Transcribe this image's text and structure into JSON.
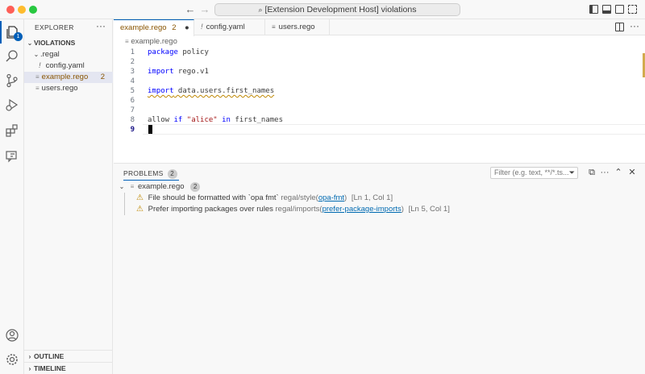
{
  "window": {
    "title": "[Extension Development Host] violations",
    "back_icon": "arrow-left",
    "forward_icon": "arrow-right"
  },
  "activity_bar": {
    "explorer_badge": "1",
    "items": [
      "files-icon",
      "search-icon",
      "source-control-icon",
      "run-debug-icon",
      "extensions-icon",
      "remote-explorer-icon",
      "account-icon",
      "gear-icon"
    ]
  },
  "sidebar": {
    "title": "EXPLORER",
    "more": "···",
    "folder": "VIOLATIONS",
    "items": [
      {
        "label": ".regal",
        "icon": "chevron-down"
      },
      {
        "label": "config.yaml",
        "icon": "!"
      },
      {
        "label": "example.rego",
        "badge": "2"
      },
      {
        "label": "users.rego"
      }
    ],
    "outline": "OUTLINE",
    "timeline": "TIMELINE"
  },
  "tabs": [
    {
      "label": "example.rego",
      "count": "2",
      "dirty": "●",
      "active": true
    },
    {
      "label": "config.yaml",
      "icon": "!"
    },
    {
      "label": "users.rego"
    }
  ],
  "breadcrumb": "example.rego",
  "code": {
    "lines": [
      {
        "n": "1",
        "kw": "package",
        "rest": " policy"
      },
      {
        "n": "2"
      },
      {
        "n": "3",
        "kw": "import",
        "rest": " rego.v1"
      },
      {
        "n": "4"
      },
      {
        "n": "5",
        "kw": "import",
        "rest": " data.users.first_names"
      },
      {
        "n": "6"
      },
      {
        "n": "7"
      },
      {
        "n": "8",
        "pre": "allow ",
        "kw1": "if",
        "str": "\"alice\"",
        "kw2": "in",
        "rest": " first_names"
      },
      {
        "n": "9"
      }
    ]
  },
  "panel": {
    "tab": "PROBLEMS",
    "count": "2",
    "filter_placeholder": "Filter (e.g. text, **/*.ts...",
    "file": "example.rego",
    "file_count": "2",
    "problems": [
      {
        "message": "File should be formatted with `opa fmt`",
        "source": "regal/style(",
        "link": "opa-fmt",
        "close": ")",
        "position": "[Ln 1, Col 1]"
      },
      {
        "message": "Prefer importing packages over rules",
        "source": "regal/imports(",
        "link": "prefer-package-imports",
        "close": ")",
        "position": "[Ln 5, Col 1]"
      }
    ]
  },
  "colors": {
    "accent": "#005fb8",
    "warning": "#bf8803",
    "keyword": "#0000ff",
    "string": "#a31515",
    "link": "#006ab1"
  }
}
